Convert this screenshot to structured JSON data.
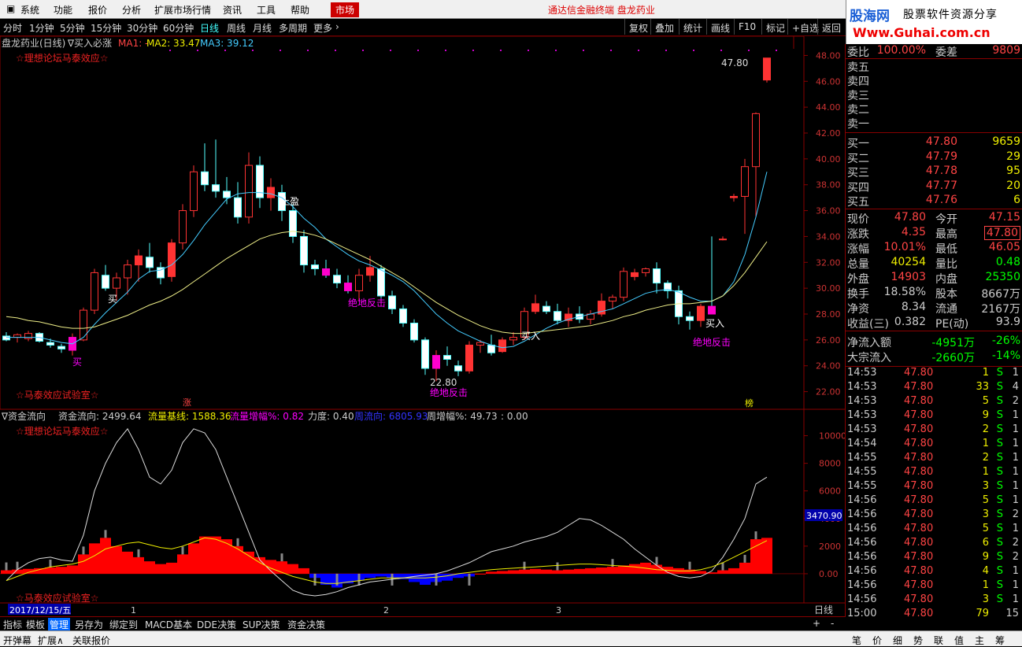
{
  "menu": {
    "items": [
      "系统",
      "功能",
      "报价",
      "分析",
      "扩展市场行情",
      "资讯",
      "工具",
      "帮助"
    ],
    "active": "市场",
    "app_title": "通达信金融终端 盘龙药业"
  },
  "logo": {
    "brand": "股海网",
    "slogan": "股票软件资源分享",
    "url": "Www.Guhai.com.cn"
  },
  "periods": {
    "items": [
      "分时",
      "1分钟",
      "5分钟",
      "15分钟",
      "30分钟",
      "60分钟",
      "日线",
      "周线",
      "月线",
      "多周期",
      "更多"
    ],
    "selected": "日线"
  },
  "toolbar_right": [
    "复权",
    "叠加",
    "统计",
    "画线",
    "F10",
    "标记",
    "+自选",
    "返回"
  ],
  "chart_header": {
    "stock": "盘龙药业(日线)",
    "indicator": "∇买入必涨",
    "ma1": "MA1: -",
    "ma2": "MA2: 33.47",
    "ma3": "MA3: 39.12",
    "watermark_top": "☆理想论坛马泰效应☆",
    "watermark_bottom": "☆马泰效应试验室☆"
  },
  "price_axis": [
    "48.00",
    "46.00",
    "44.00",
    "42.00",
    "40.00",
    "38.00",
    "36.00",
    "34.00",
    "32.00",
    "30.00",
    "28.00",
    "26.00",
    "24.00",
    "22.00"
  ],
  "annotations": {
    "high_price": "47.80",
    "low_price": "22.80",
    "stop": "止盈",
    "buy": "买入",
    "buy2": "买",
    "rebound": "绝地反击",
    "zhang": "涨",
    "bang": "榜"
  },
  "indicator_header": {
    "name": "∇资金流向",
    "flow": "资金流向: 2499.64",
    "base": "流量基线: 1588.36",
    "growth": "流量增幅%: 0.82",
    "power": "力度: 0.40",
    "dir": "周流向: 6805.93",
    "week": "周增幅%: 49.73",
    "extra": ": 0.00"
  },
  "indicator_axis": [
    "10000",
    "8000",
    "6000",
    "4000",
    "2000",
    "0.00"
  ],
  "indicator_cursor": "3470.90",
  "date_axis": {
    "date": "2017/12/15/五",
    "m1": "1",
    "m2": "2",
    "m3": "3",
    "period": "日线"
  },
  "chart_data": {
    "type": "candlestick",
    "price_ylim": [
      21,
      49
    ],
    "indicator_ylim": [
      -2000,
      11000
    ],
    "candles": [
      [
        26.3,
        26.6,
        25.9,
        26.0
      ],
      [
        26.2,
        26.5,
        25.8,
        26.4
      ],
      [
        26.1,
        26.7,
        25.9,
        26.5
      ],
      [
        26.5,
        26.6,
        25.8,
        25.9
      ],
      [
        25.8,
        26.1,
        25.4,
        25.6
      ],
      [
        25.5,
        25.7,
        25.0,
        25.3
      ],
      [
        25.2,
        26.5,
        24.8,
        26.2
      ],
      [
        26.0,
        28.5,
        25.9,
        28.3
      ],
      [
        28.3,
        31.5,
        28.0,
        31.2
      ],
      [
        31.0,
        31.8,
        29.8,
        30.0
      ],
      [
        30.0,
        31.2,
        29.0,
        30.8
      ],
      [
        30.8,
        32.2,
        29.5,
        31.8
      ],
      [
        31.8,
        33.0,
        30.5,
        32.5
      ],
      [
        32.4,
        33.5,
        31.2,
        31.6
      ],
      [
        31.6,
        32.0,
        30.3,
        30.8
      ],
      [
        30.9,
        33.8,
        30.5,
        33.5
      ],
      [
        33.5,
        36.5,
        33.0,
        36.0
      ],
      [
        36.0,
        39.5,
        35.5,
        39.0
      ],
      [
        39.0,
        41.2,
        37.5,
        38.0
      ],
      [
        38.0,
        41.5,
        37.0,
        37.5
      ],
      [
        37.5,
        38.6,
        36.5,
        37.0
      ],
      [
        37.0,
        38.2,
        35.0,
        35.5
      ],
      [
        35.5,
        40.5,
        35.0,
        39.5
      ],
      [
        39.5,
        40.2,
        36.2,
        37.0
      ],
      [
        37.0,
        38.5,
        36.0,
        37.8
      ],
      [
        37.4,
        38.0,
        35.2,
        36.0
      ],
      [
        36.0,
        36.5,
        33.5,
        34.0
      ],
      [
        34.0,
        34.5,
        31.2,
        31.8
      ],
      [
        31.8,
        32.2,
        31.0,
        31.5
      ],
      [
        31.5,
        32.2,
        30.8,
        31.0
      ],
      [
        31.0,
        31.5,
        30.0,
        30.4
      ],
      [
        30.4,
        31.0,
        29.6,
        29.8
      ],
      [
        29.8,
        31.5,
        29.0,
        31.0
      ],
      [
        31.0,
        32.5,
        30.5,
        31.6
      ],
      [
        31.5,
        31.8,
        29.0,
        29.4
      ],
      [
        29.4,
        29.8,
        28.0,
        28.4
      ],
      [
        28.4,
        28.7,
        27.0,
        27.3
      ],
      [
        27.3,
        27.6,
        25.8,
        26.0
      ],
      [
        26.0,
        26.2,
        23.3,
        23.8
      ],
      [
        23.8,
        25.2,
        22.8,
        24.8
      ],
      [
        24.8,
        25.5,
        24.0,
        24.5
      ],
      [
        24.0,
        24.4,
        23.2,
        23.6
      ],
      [
        23.6,
        25.9,
        23.4,
        25.6
      ],
      [
        25.6,
        26.0,
        25.0,
        25.8
      ],
      [
        25.6,
        26.4,
        24.8,
        25.0
      ],
      [
        25.1,
        26.2,
        25.0,
        26.0
      ],
      [
        26.0,
        26.6,
        25.6,
        26.2
      ],
      [
        26.2,
        28.5,
        26.0,
        28.2
      ],
      [
        28.2,
        29.5,
        28.0,
        28.8
      ],
      [
        28.6,
        29.0,
        28.0,
        28.2
      ],
      [
        28.2,
        28.8,
        27.2,
        27.5
      ],
      [
        27.5,
        28.5,
        27.0,
        28.0
      ],
      [
        28.0,
        28.6,
        27.3,
        27.6
      ],
      [
        27.6,
        28.3,
        27.2,
        28.0
      ],
      [
        28.0,
        29.6,
        27.8,
        29.0
      ],
      [
        29.0,
        29.5,
        28.4,
        29.3
      ],
      [
        29.3,
        31.6,
        29.0,
        31.3
      ],
      [
        30.9,
        31.5,
        30.6,
        31.2
      ],
      [
        31.2,
        31.6,
        30.9,
        31.5
      ],
      [
        31.5,
        32.0,
        29.6,
        30.4
      ],
      [
        30.4,
        30.6,
        29.2,
        29.8
      ],
      [
        29.8,
        30.2,
        27.2,
        27.8
      ],
      [
        27.8,
        28.2,
        26.8,
        27.5
      ],
      [
        27.5,
        28.8,
        27.0,
        28.6
      ],
      [
        28.6,
        34.0,
        28.0,
        28.0
      ],
      [
        33.8,
        34.0,
        33.7,
        33.8
      ],
      [
        37.0,
        37.3,
        36.7,
        37.1
      ],
      [
        37.1,
        40.0,
        34.2,
        39.4
      ],
      [
        39.4,
        43.6,
        35.5,
        43.5
      ],
      [
        46.1,
        47.8,
        45.9,
        47.8
      ]
    ],
    "ma_fast": [
      26.2,
      26.2,
      26.2,
      26.2,
      26.0,
      25.8,
      25.7,
      26.2,
      27.2,
      28.1,
      28.9,
      29.7,
      30.7,
      31.3,
      31.4,
      31.8,
      32.6,
      33.7,
      34.9,
      35.9,
      36.9,
      37.3,
      37.4,
      37.4,
      37.3,
      37.0,
      36.3,
      35.4,
      34.7,
      33.8,
      33.2,
      32.6,
      32.1,
      31.8,
      31.4,
      31.0,
      30.5,
      29.8,
      28.9,
      28.0,
      27.3,
      26.7,
      26.3,
      25.9,
      25.6,
      25.4,
      25.5,
      25.9,
      26.4,
      26.9,
      27.3,
      27.6,
      27.8,
      28.0,
      28.2,
      28.4,
      28.8,
      29.2,
      29.6,
      29.8,
      29.9,
      29.7,
      29.3,
      29.0,
      29.0,
      29.4,
      30.5,
      32.6,
      35.5,
      39.0
    ],
    "ma_slow": [
      27.8,
      27.7,
      27.5,
      27.4,
      27.2,
      27.0,
      26.9,
      26.9,
      27.0,
      27.3,
      27.6,
      27.9,
      28.3,
      28.7,
      29.0,
      29.4,
      29.9,
      30.5,
      31.1,
      31.7,
      32.3,
      32.8,
      33.3,
      33.8,
      34.1,
      34.3,
      34.4,
      34.3,
      34.1,
      33.8,
      33.4,
      33.0,
      32.6,
      32.2,
      31.7,
      31.2,
      30.7,
      30.1,
      29.5,
      28.9,
      28.4,
      27.9,
      27.5,
      27.1,
      26.8,
      26.6,
      26.5,
      26.5,
      26.6,
      26.7,
      26.8,
      26.9,
      27.0,
      27.1,
      27.3,
      27.5,
      27.8,
      28.0,
      28.3,
      28.5,
      28.7,
      28.8,
      28.8,
      28.9,
      29.0,
      29.4,
      30.2,
      31.2,
      32.4,
      33.6
    ],
    "fund_bars": [
      250,
      300,
      350,
      400,
      450,
      500,
      600,
      1400,
      2200,
      2600,
      2000,
      1600,
      1200,
      900,
      700,
      800,
      1400,
      2200,
      2700,
      2700,
      2500,
      2000,
      1600,
      1200,
      1000,
      900,
      700,
      400,
      -300,
      -800,
      -1000,
      -700,
      -500,
      -300,
      -200,
      -300,
      -400,
      -600,
      -800,
      -600,
      -500,
      -300,
      -200,
      0,
      150,
      200,
      250,
      300,
      350,
      300,
      250,
      300,
      350,
      400,
      450,
      500,
      600,
      700,
      800,
      650,
      500,
      400,
      300,
      200,
      100,
      250,
      400,
      800,
      2500,
      2600
    ],
    "flow_line": [
      -500,
      300,
      800,
      1100,
      1200,
      1000,
      900,
      2800,
      6000,
      8000,
      9500,
      10500,
      9000,
      7000,
      6500,
      7500,
      9500,
      10500,
      10200,
      9000,
      7000,
      5000,
      3000,
      1000,
      200,
      -500,
      -1200,
      -1500,
      -1600,
      -1500,
      -1300,
      -1000,
      -800,
      -600,
      -500,
      -400,
      -300,
      -200,
      -100,
      0,
      200,
      500,
      800,
      1200,
      1600,
      1800,
      2000,
      2300,
      2500,
      2700,
      3000,
      3500,
      4000,
      3900,
      3500,
      3000,
      2500,
      1800,
      1200,
      600,
      100,
      -200,
      -300,
      -200,
      200,
      1200,
      2500,
      4000,
      6500,
      7000
    ],
    "flow_base": [
      -500,
      -200,
      100,
      300,
      500,
      600,
      700,
      900,
      1300,
      1800,
      2000,
      2200,
      2300,
      2100,
      1900,
      1800,
      2000,
      2300,
      2600,
      2500,
      2200,
      1800,
      1300,
      800,
      400,
      100,
      -200,
      -400,
      -600,
      -700,
      -700,
      -600,
      -500,
      -400,
      -300,
      -300,
      -300,
      -300,
      -300,
      -250,
      -150,
      0,
      100,
      200,
      300,
      350,
      400,
      450,
      500,
      550,
      600,
      650,
      700,
      700,
      650,
      600,
      550,
      500,
      400,
      300,
      250,
      200,
      200,
      300,
      500,
      800,
      1200,
      1600,
      2000,
      2400
    ],
    "volume_ticks": [
      1,
      1,
      0,
      0,
      1,
      0,
      0,
      1,
      0,
      1,
      0,
      0,
      1,
      0,
      0,
      0,
      1,
      0,
      0,
      0,
      0,
      1,
      0,
      0,
      0,
      1,
      0,
      0,
      1,
      0,
      1,
      0,
      1,
      0,
      0,
      1,
      0,
      0,
      0,
      1,
      0,
      0,
      1,
      0,
      0,
      0,
      0,
      1,
      0,
      0,
      1,
      0,
      0,
      0,
      0,
      1,
      0,
      0,
      0,
      1,
      0,
      0,
      1,
      0,
      0,
      1,
      0,
      1,
      1,
      0
    ]
  },
  "quote": {
    "wb_label": "委比",
    "wb": "100.00%",
    "wc_label": "委差",
    "wc": "9809",
    "sell": [
      [
        "卖五",
        ""
      ],
      [
        "卖四",
        ""
      ],
      [
        "卖三",
        ""
      ],
      [
        "卖二",
        ""
      ],
      [
        "卖一",
        ""
      ]
    ],
    "buy": [
      [
        "买一",
        "47.80",
        "9659"
      ],
      [
        "买二",
        "47.79",
        "29"
      ],
      [
        "买三",
        "47.78",
        "95"
      ],
      [
        "买四",
        "47.77",
        "20"
      ],
      [
        "买五",
        "47.76",
        "6"
      ]
    ],
    "stats": [
      [
        "现价",
        "47.80",
        "今开",
        "47.15"
      ],
      [
        "涨跌",
        "4.35",
        "最高",
        "47.80"
      ],
      [
        "涨幅",
        "10.01%",
        "最低",
        "46.05"
      ],
      [
        "总量",
        "40254",
        "量比",
        "0.48"
      ],
      [
        "外盘",
        "14903",
        "内盘",
        "25350"
      ],
      [
        "换手",
        "18.58%",
        "股本",
        "8667万"
      ],
      [
        "净资",
        "8.34",
        "流通",
        "2167万"
      ],
      [
        "收益(三)",
        "0.382",
        "PE(动)",
        "93.9"
      ]
    ],
    "net_flow_label": "净流入额",
    "net_flow": "-4951万",
    "net_flow_pct": "-26%",
    "big_flow_label": "大宗流入",
    "big_flow": "-2660万",
    "big_flow_pct": "-14%"
  },
  "ticks": [
    [
      "14:53",
      "47.80",
      "1",
      "S",
      "1"
    ],
    [
      "14:53",
      "47.80",
      "33",
      "S",
      "4"
    ],
    [
      "14:53",
      "47.80",
      "5",
      "S",
      "2"
    ],
    [
      "14:53",
      "47.80",
      "9",
      "S",
      "1"
    ],
    [
      "14:53",
      "47.80",
      "2",
      "S",
      "1"
    ],
    [
      "14:54",
      "47.80",
      "1",
      "S",
      "1"
    ],
    [
      "14:55",
      "47.80",
      "2",
      "S",
      "1"
    ],
    [
      "14:55",
      "47.80",
      "1",
      "S",
      "1"
    ],
    [
      "14:55",
      "47.80",
      "3",
      "S",
      "1"
    ],
    [
      "14:56",
      "47.80",
      "5",
      "S",
      "1"
    ],
    [
      "14:56",
      "47.80",
      "3",
      "S",
      "2"
    ],
    [
      "14:56",
      "47.80",
      "5",
      "S",
      "1"
    ],
    [
      "14:56",
      "47.80",
      "6",
      "S",
      "2"
    ],
    [
      "14:56",
      "47.80",
      "9",
      "S",
      "2"
    ],
    [
      "14:56",
      "47.80",
      "4",
      "S",
      "1"
    ],
    [
      "14:56",
      "47.80",
      "1",
      "S",
      "1"
    ],
    [
      "14:56",
      "47.80",
      "3",
      "S",
      "1"
    ],
    [
      "15:00",
      "47.80",
      "79",
      "",
      "15"
    ]
  ],
  "bottom_tabs": [
    "指标",
    "模板",
    "管理",
    "另存为",
    "绑定到",
    "MACD基本",
    "DDE决策",
    "SUP决策",
    "资金决策"
  ],
  "bottom_selected": "管理",
  "status_left": [
    "开弹幕",
    "扩展∧",
    "关联报价"
  ],
  "status_right": [
    "笔",
    "价",
    "细",
    "势",
    "联",
    "值",
    "主",
    "筹"
  ]
}
